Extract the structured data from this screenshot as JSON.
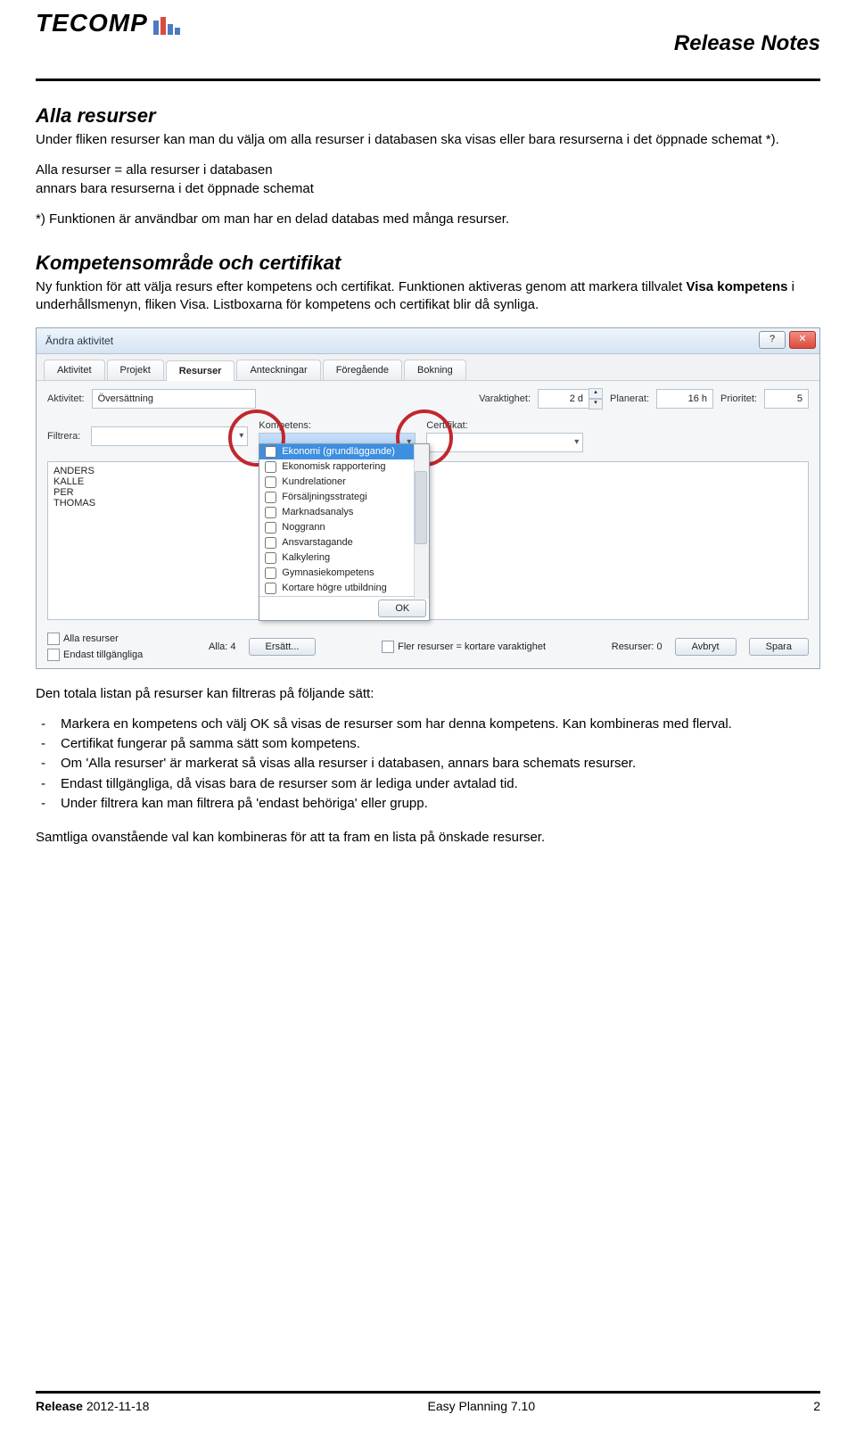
{
  "header": {
    "logo_text": "TECOMP",
    "doc_title": "Release Notes"
  },
  "section1": {
    "title": "Alla resurser",
    "p1": "Under fliken resurser kan man du välja om alla resurser i databasen ska visas eller bara resurserna i det öppnade schemat *).",
    "p2": "Alla resurser = alla resurser i databasen\nannars bara resurserna i det öppnade schemat",
    "p3": "*) Funktionen är användbar om man har en delad databas med många resurser."
  },
  "section2": {
    "title": "Kompetensområde och certifikat",
    "p1": "Ny funktion för att välja resurs efter kompetens och certifikat. Funktionen aktiveras genom att markera tillvalet Visa kompetens i underhållsmenyn, fliken Visa. Listboxarna för kompetens och certifikat blir då synliga.",
    "bold_in_p1": "Visa kompetens"
  },
  "dialog": {
    "title": "Ändra aktivitet",
    "help": "?",
    "close": "✕",
    "tabs": [
      "Aktivitet",
      "Projekt",
      "Resurser",
      "Anteckningar",
      "Föregående",
      "Bokning"
    ],
    "active_tab": 2,
    "row1": {
      "aktivitet_lbl": "Aktivitet:",
      "aktivitet_val": "Översättning",
      "varaktighet_lbl": "Varaktighet:",
      "varaktighet_val": "2 d",
      "planerat_lbl": "Planerat:",
      "planerat_val": "16 h",
      "prioritet_lbl": "Prioritet:",
      "prioritet_val": "5"
    },
    "row2": {
      "filtrera_lbl": "Filtrera:",
      "kompetens_lbl": "Kompetens:",
      "certifikat_lbl": "Certifikat:"
    },
    "dropdown_items": [
      "Ekonomi (grundläggande)",
      "Ekonomisk rapportering",
      "Kundrelationer",
      "Försäljningsstrategi",
      "Marknadsanalys",
      "Noggrann",
      "Ansvarstagande",
      "Kalkylering",
      "Gymnasiekompetens",
      "Kortare högre utbildning"
    ],
    "dropdown_hi": 0,
    "ok": "OK",
    "list": [
      "ANDERS",
      "KALLE",
      "PER",
      "THOMAS"
    ],
    "bottom": {
      "alla_resurser": "Alla resurser",
      "endast": "Endast tillgängliga",
      "alla_lbl": "Alla:",
      "alla_val": "4",
      "fler": "Fler resurser = kortare varaktighet",
      "resurser_lbl": "Resurser:",
      "resurser_val": "0",
      "ersatt": "Ersätt...",
      "avbryt": "Avbryt",
      "spara": "Spara"
    }
  },
  "after": {
    "lead": "Den totala listan på resurser kan filtreras på följande sätt:",
    "bullets": [
      "Markera en kompetens och välj OK så visas de resurser som har denna kompetens. Kan kombineras med flerval.",
      "Certifikat fungerar på samma sätt som kompetens.",
      "Om 'Alla resurser' är markerat så visas alla resurser i databasen, annars bara schemats resurser.",
      "Endast tillgängliga, då visas bara de resurser som är lediga under avtalad tid.",
      "Under filtrera kan man filtrera på 'endast behöriga' eller grupp."
    ],
    "closing": "Samtliga ovanstående val kan kombineras för att ta fram en lista på önskade resurser."
  },
  "footer": {
    "release_lbl": "Release",
    "release_date": "2012-11-18",
    "product": "Easy Planning 7.10",
    "page": "2"
  }
}
